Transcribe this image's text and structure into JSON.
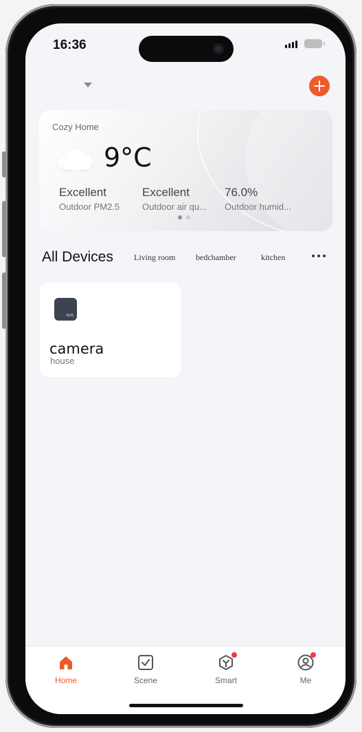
{
  "status_bar": {
    "time": "16:36"
  },
  "weather": {
    "home_name": "Cozy Home",
    "temperature": "9°C",
    "icon": "cloud-icon",
    "metrics": [
      {
        "value": "Excellent",
        "label": "Outdoor PM2.5"
      },
      {
        "value": "Excellent",
        "label": "Outdoor air qu..."
      },
      {
        "value": "76.0%",
        "label": "Outdoor humid..."
      }
    ],
    "page_count": 2,
    "active_page": 1
  },
  "devices": {
    "title": "All Devices",
    "rooms": [
      "Living room",
      "bedchamber",
      "kitchen"
    ],
    "items": [
      {
        "name": "camera",
        "room": "house",
        "icon_text": "NVR"
      }
    ]
  },
  "tab_bar": {
    "tabs": [
      {
        "label": "Home",
        "icon": "home-icon",
        "active": true
      },
      {
        "label": "Scene",
        "icon": "scene-checkbox-icon",
        "active": false
      },
      {
        "label": "Smart",
        "icon": "smart-cube-icon",
        "active": false,
        "badge": true
      },
      {
        "label": "Me",
        "icon": "profile-icon",
        "active": false,
        "badge": true
      }
    ]
  },
  "colors": {
    "accent": "#f05a28",
    "badge": "#ef3b3b",
    "background": "#f4f5f9"
  }
}
